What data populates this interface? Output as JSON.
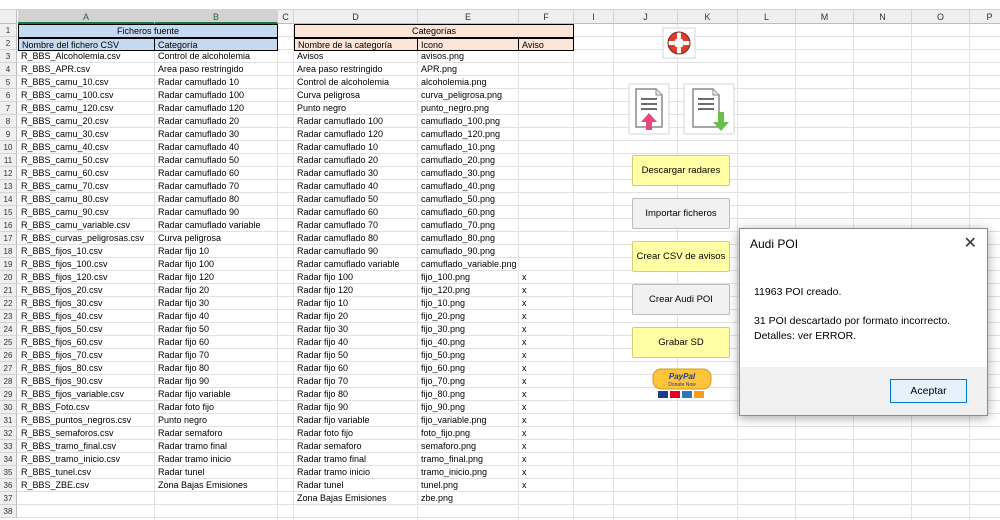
{
  "columns": [
    "A",
    "B",
    "C",
    "D",
    "E",
    "F",
    "I",
    "J",
    "K",
    "L",
    "M",
    "N",
    "O",
    "P"
  ],
  "row_numbers": [
    "1",
    "2",
    "3",
    "4",
    "5",
    "6",
    "7",
    "8",
    "9",
    "10",
    "11",
    "12",
    "13",
    "14",
    "15",
    "16",
    "17",
    "18",
    "19",
    "20",
    "21",
    "22",
    "23",
    "24",
    "25",
    "26",
    "27",
    "28",
    "29",
    "30",
    "31",
    "32",
    "33",
    "34",
    "35",
    "36",
    "37",
    "38"
  ],
  "source_table": {
    "title": "Ficheros fuente",
    "headers": [
      "Nombre del fichero CSV",
      "Categoría"
    ],
    "rows": [
      [
        "R_BBS_Alcoholemia.csv",
        "Control de alcoholemia"
      ],
      [
        "R_BBS_APR.csv",
        "Area paso restringido"
      ],
      [
        "R_BBS_camu_10.csv",
        "Radar camuflado 10"
      ],
      [
        "R_BBS_camu_100.csv",
        "Radar camuflado 100"
      ],
      [
        "R_BBS_camu_120.csv",
        "Radar camuflado 120"
      ],
      [
        "R_BBS_camu_20.csv",
        "Radar camuflado 20"
      ],
      [
        "R_BBS_camu_30.csv",
        "Radar camuflado 30"
      ],
      [
        "R_BBS_camu_40.csv",
        "Radar camuflado 40"
      ],
      [
        "R_BBS_camu_50.csv",
        "Radar camuflado 50"
      ],
      [
        "R_BBS_camu_60.csv",
        "Radar camuflado 60"
      ],
      [
        "R_BBS_camu_70.csv",
        "Radar camuflado 70"
      ],
      [
        "R_BBS_camu_80.csv",
        "Radar camuflado 80"
      ],
      [
        "R_BBS_camu_90.csv",
        "Radar camuflado 90"
      ],
      [
        "R_BBS_camu_variable.csv",
        "Radar camuflado variable"
      ],
      [
        "R_BBS_curvas_peligrosas.csv",
        "Curva peligrosa"
      ],
      [
        "R_BBS_fijos_10.csv",
        "Radar fijo 10"
      ],
      [
        "R_BBS_fijos_100.csv",
        "Radar fijo 100"
      ],
      [
        "R_BBS_fijos_120.csv",
        "Radar fijo 120"
      ],
      [
        "R_BBS_fijos_20.csv",
        "Radar fijo 20"
      ],
      [
        "R_BBS_fijos_30.csv",
        "Radar fijo 30"
      ],
      [
        "R_BBS_fijos_40.csv",
        "Radar fijo 40"
      ],
      [
        "R_BBS_fijos_50.csv",
        "Radar fijo 50"
      ],
      [
        "R_BBS_fijos_60.csv",
        "Radar fijo 60"
      ],
      [
        "R_BBS_fijos_70.csv",
        "Radar fijo 70"
      ],
      [
        "R_BBS_fijos_80.csv",
        "Radar fijo 80"
      ],
      [
        "R_BBS_fijos_90.csv",
        "Radar fijo 90"
      ],
      [
        "R_BBS_fijos_variable.csv",
        "Radar fijo variable"
      ],
      [
        "R_BBS_Foto.csv",
        "Radar foto fijo"
      ],
      [
        "R_BBS_puntos_negros.csv",
        "Punto negro"
      ],
      [
        "R_BBS_semaforos.csv",
        "Radar semaforo"
      ],
      [
        "R_BBS_tramo_final.csv",
        "Radar tramo final"
      ],
      [
        "R_BBS_tramo_inicio.csv",
        "Radar tramo inicio"
      ],
      [
        "R_BBS_tunel.csv",
        "Radar tunel"
      ],
      [
        "R_BBS_ZBE.csv",
        "Zona Bajas Emisiones"
      ]
    ]
  },
  "categories_table": {
    "title": "Categorías",
    "headers": [
      "Nombre de la categoría",
      "Icono",
      "Aviso"
    ],
    "rows": [
      [
        "Avisos",
        "avisos.png",
        ""
      ],
      [
        "Area paso restringido",
        "APR.png",
        ""
      ],
      [
        "Control de alcoholemia",
        "alcoholemia.png",
        ""
      ],
      [
        "Curva peligrosa",
        "curva_peligrosa.png",
        ""
      ],
      [
        "Punto negro",
        "punto_negro.png",
        ""
      ],
      [
        "Radar camuflado 100",
        "camuflado_100.png",
        ""
      ],
      [
        "Radar camuflado 120",
        "camuflado_120.png",
        ""
      ],
      [
        "Radar camuflado 10",
        "camuflado_10.png",
        ""
      ],
      [
        "Radar camuflado 20",
        "camuflado_20.png",
        ""
      ],
      [
        "Radar camuflado 30",
        "camuflado_30.png",
        ""
      ],
      [
        "Radar camuflado 40",
        "camuflado_40.png",
        ""
      ],
      [
        "Radar camuflado 50",
        "camuflado_50.png",
        ""
      ],
      [
        "Radar camuflado 60",
        "camuflado_60.png",
        ""
      ],
      [
        "Radar camuflado 70",
        "camuflado_70.png",
        ""
      ],
      [
        "Radar camuflado 80",
        "camuflado_80.png",
        ""
      ],
      [
        "Radar camuflado 90",
        "camuflado_90.png",
        ""
      ],
      [
        "Radar camuflado variable",
        "camuflado_variable.png",
        ""
      ],
      [
        "Radar fijo 100",
        "fijo_100.png",
        "x"
      ],
      [
        "Radar fijo 120",
        "fijo_120.png",
        "x"
      ],
      [
        "Radar fijo 10",
        "fijo_10.png",
        "x"
      ],
      [
        "Radar fijo 20",
        "fijo_20.png",
        "x"
      ],
      [
        "Radar fijo 30",
        "fijo_30.png",
        "x"
      ],
      [
        "Radar fijo 40",
        "fijo_40.png",
        "x"
      ],
      [
        "Radar fijo 50",
        "fijo_50.png",
        "x"
      ],
      [
        "Radar fijo 60",
        "fijo_60.png",
        "x"
      ],
      [
        "Radar fijo 70",
        "fijo_70.png",
        "x"
      ],
      [
        "Radar fijo 80",
        "fijo_80.png",
        "x"
      ],
      [
        "Radar fijo 90",
        "fijo_90.png",
        "x"
      ],
      [
        "Radar fijo variable",
        "fijo_variable.png",
        "x"
      ],
      [
        "Radar foto fijo",
        "foto_fijo.png",
        "x"
      ],
      [
        "Radar semaforo",
        "semaforo.png",
        "x"
      ],
      [
        "Radar tramo final",
        "tramo_final.png",
        "x"
      ],
      [
        "Radar tramo inicio",
        "tramo_inicio.png",
        "x"
      ],
      [
        "Radar tunel",
        "tunel.png",
        "x"
      ],
      [
        "Zona Bajas Emisiones",
        "zbe.png",
        ""
      ]
    ]
  },
  "buttons": {
    "download": "Descargar radares",
    "import": "Importar ficheros",
    "create_csv": "Crear CSV de avisos",
    "create_audi": "Crear Audi POI",
    "record_sd": "Grabar SD"
  },
  "paypal": {
    "brand": "PayPal",
    "tagline": "Donate Now"
  },
  "icons": {
    "lifebuoy": "lifebuoy-icon",
    "upload": "document-upload-icon",
    "download": "document-download-icon"
  },
  "dialog": {
    "title": "Audi POI",
    "close_glyph": "✕",
    "line1": "11963 POI creado.",
    "line2": "31 POI descartado por formato incorrecto.",
    "line3": "Detalles: ver ERROR.",
    "ok_label": "Aceptar"
  },
  "colors": {
    "header_blue": "#c5d9f1",
    "header_orange": "#fce4d6",
    "button_yellow": "#ffffa6",
    "button_gray": "#f1f1f1",
    "excel_green": "#217346"
  }
}
